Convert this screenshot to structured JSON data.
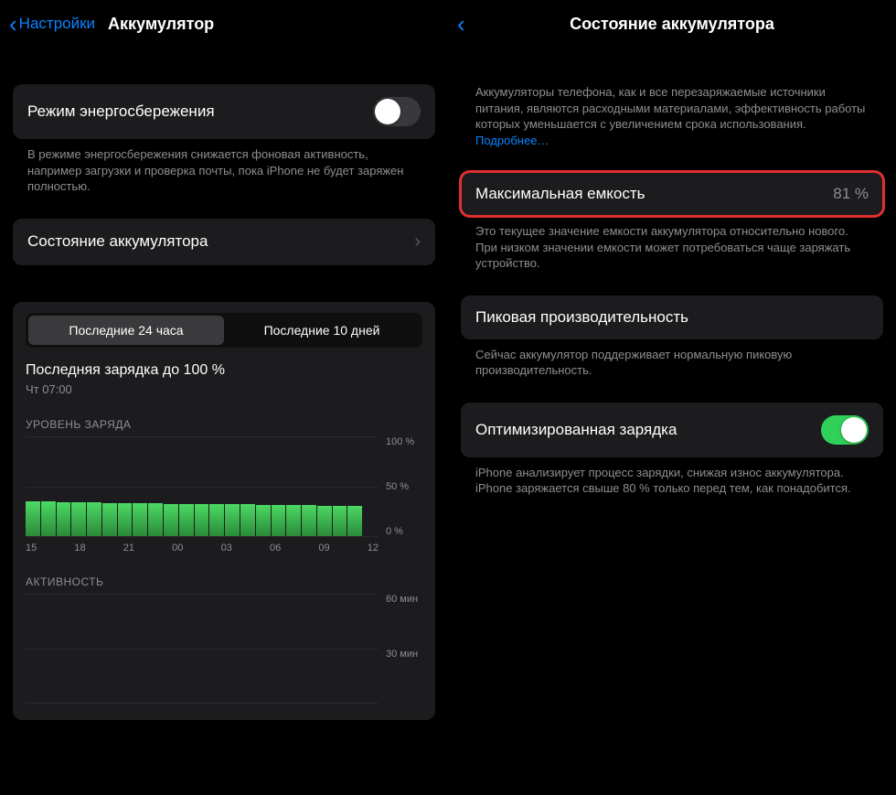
{
  "left": {
    "nav": {
      "back": "Настройки",
      "title": "Аккумулятор"
    },
    "lowPower": {
      "label": "Режим энергосбережения",
      "footnote": "В режиме энергосбережения снижается фоновая активность, например загрузки и проверка почты, пока iPhone не будет заряжен полностью."
    },
    "healthRow": {
      "label": "Состояние аккумулятора"
    },
    "seg": {
      "a": "Последние 24 часа",
      "b": "Последние 10 дней"
    },
    "lastCharge": {
      "title": "Последняя зарядка до 100 %",
      "sub": "Чт 07:00"
    },
    "chartLevel": {
      "title": "УРОВЕНЬ ЗАРЯДА",
      "yticks": [
        "100 %",
        "50 %",
        "0 %"
      ],
      "xticks": [
        "15",
        "18",
        "21",
        "00",
        "03",
        "06",
        "09",
        "12"
      ]
    },
    "chartActivity": {
      "title": "АКТИВНОСТЬ",
      "yticks": [
        "60 мин",
        "30 мин",
        ""
      ]
    }
  },
  "right": {
    "nav": {
      "title": "Состояние аккумулятора"
    },
    "intro": "Аккумуляторы телефона, как и все перезаряжаемые источники питания, являются расходными материалами, эффективность работы которых уменьшается с увеличением срока использования. ",
    "introLink": "Подробнее…",
    "capacity": {
      "label": "Максимальная емкость",
      "value": "81 %"
    },
    "capacityFoot": "Это текущее значение емкости аккумулятора относительно нового. При низком значении емкости может потребоваться чаще заряжать устройство.",
    "peak": {
      "label": "Пиковая производительность"
    },
    "peakFoot": "Сейчас аккумулятор поддерживает нормальную пиковую производительность.",
    "optimized": {
      "label": "Оптимизированная зарядка"
    },
    "optimizedFoot": "iPhone анализирует процесс зарядки, снижая износ аккумулятора. iPhone заряжается свыше 80 % только перед тем, как понадобится."
  },
  "chart_data": {
    "type": "bar",
    "title": "УРОВЕНЬ ЗАРЯДА",
    "xlabel": "",
    "ylabel": "",
    "ylim": [
      0,
      100
    ],
    "categories": [
      "15",
      "16",
      "17",
      "18",
      "19",
      "20",
      "21",
      "22",
      "23",
      "00",
      "01",
      "02",
      "03",
      "04",
      "05",
      "06",
      "07",
      "08",
      "09",
      "10",
      "11",
      "12",
      "13"
    ],
    "values": [
      35,
      35,
      34,
      34,
      34,
      33,
      33,
      33,
      33,
      32,
      32,
      32,
      32,
      32,
      32,
      31,
      31,
      31,
      31,
      30,
      30,
      30,
      0
    ],
    "xticks_shown": [
      "15",
      "18",
      "21",
      "00",
      "03",
      "06",
      "09",
      "12"
    ]
  }
}
